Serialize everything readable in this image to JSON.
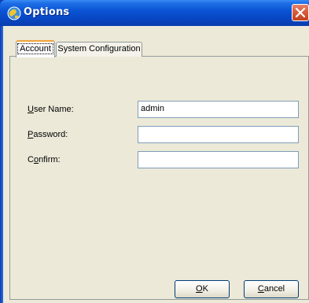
{
  "window": {
    "title": "Options",
    "app_icon": "globe-icon",
    "close_icon": "close-icon",
    "accent_color": "#0b55d6",
    "close_color": "#d85d3c"
  },
  "tabs": [
    {
      "label": "Account",
      "selected": true
    },
    {
      "label": "System Configuration",
      "selected": false
    }
  ],
  "form": {
    "user_name": {
      "label_u": "U",
      "label_rest": "ser Name:",
      "value": "admin"
    },
    "password": {
      "label_u": "P",
      "label_rest": "assword:",
      "value": ""
    },
    "confirm": {
      "label_pre": "C",
      "label_u": "o",
      "label_rest": "nfirm:",
      "value": ""
    }
  },
  "buttons": {
    "ok": {
      "label_u": "O",
      "label_rest": "K"
    },
    "cancel": {
      "label_u": "C",
      "label_rest": "ancel"
    }
  }
}
